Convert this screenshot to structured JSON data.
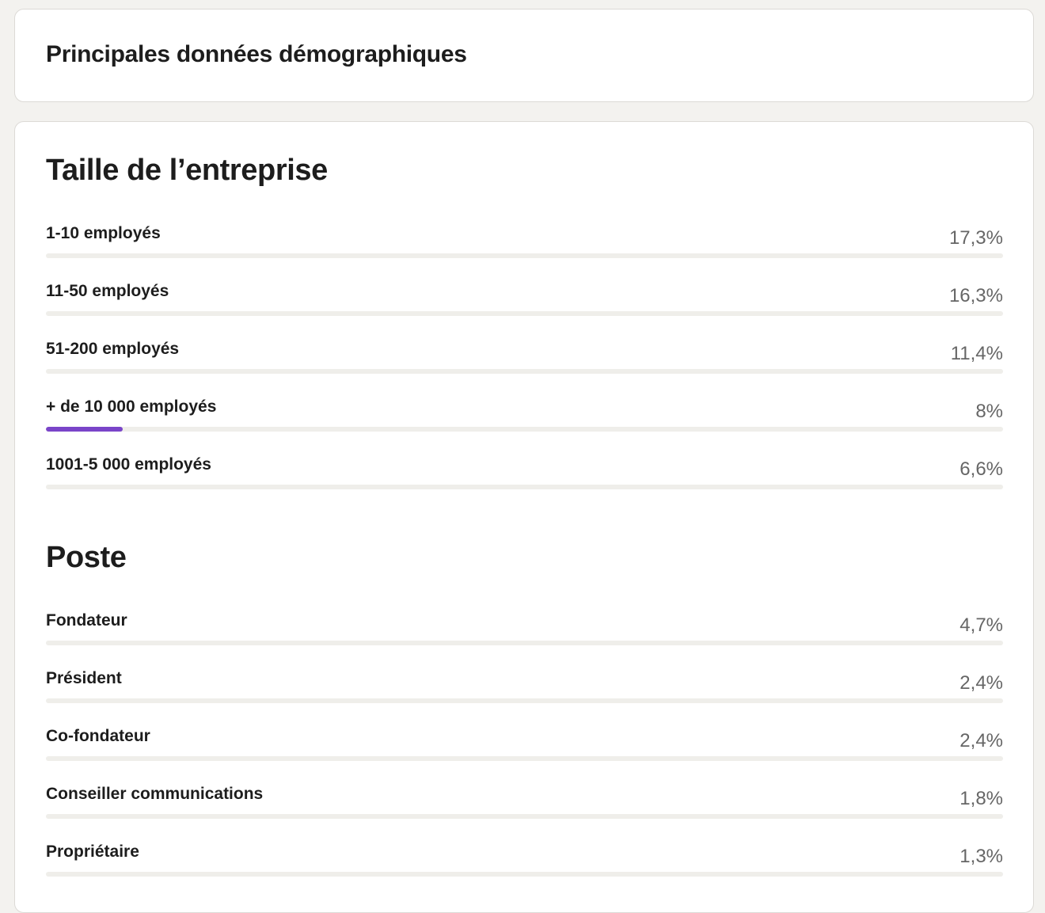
{
  "header": {
    "title": "Principales données démographiques"
  },
  "sections": [
    {
      "title": "Taille de l’entreprise",
      "rows": [
        {
          "label": "1-10 employés",
          "value": "17,3%",
          "fraction": 0.173,
          "highlighted": false
        },
        {
          "label": "11-50 employés",
          "value": "16,3%",
          "fraction": 0.163,
          "highlighted": false
        },
        {
          "label": "51-200 employés",
          "value": "11,4%",
          "fraction": 0.114,
          "highlighted": false
        },
        {
          "label": "+ de 10 000 employés",
          "value": "8%",
          "fraction": 0.08,
          "highlighted": true
        },
        {
          "label": "1001-5 000 employés",
          "value": "6,6%",
          "fraction": 0.066,
          "highlighted": false
        }
      ]
    },
    {
      "title": "Poste",
      "rows": [
        {
          "label": "Fondateur",
          "value": "4,7%",
          "fraction": 0.047,
          "highlighted": false
        },
        {
          "label": "Président",
          "value": "2,4%",
          "fraction": 0.024,
          "highlighted": false
        },
        {
          "label": "Co-fondateur",
          "value": "2,4%",
          "fraction": 0.024,
          "highlighted": false
        },
        {
          "label": "Conseiller communications",
          "value": "1,8%",
          "fraction": 0.018,
          "highlighted": false
        },
        {
          "label": "Propriétaire",
          "value": "1,3%",
          "fraction": 0.013,
          "highlighted": false
        }
      ]
    }
  ],
  "colors": {
    "highlight_fill": "#7a45c9",
    "track": "#efeeea",
    "background": "#f3f2ef"
  }
}
